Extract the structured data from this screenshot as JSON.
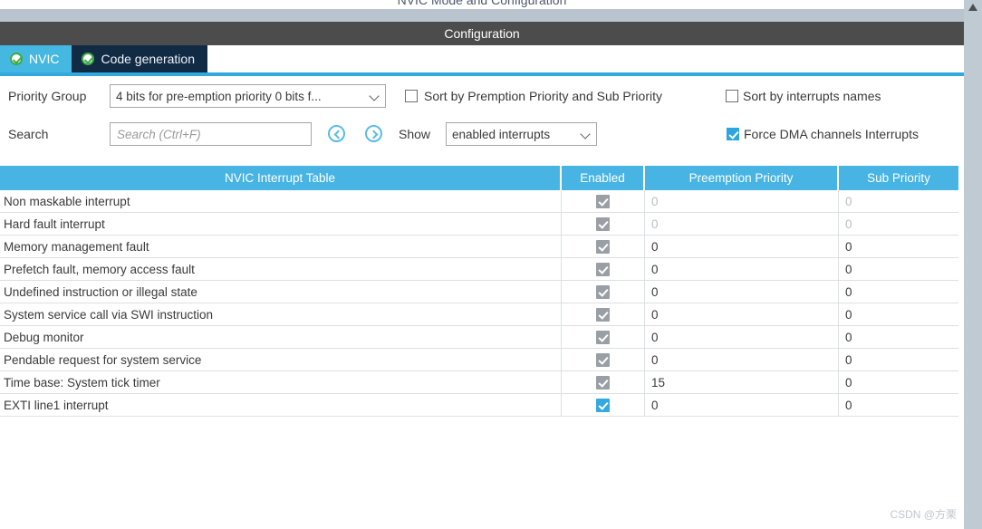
{
  "window": {
    "clipped_title": "NVIC Mode and Configuration",
    "config_bar_title": "Configuration"
  },
  "tabs": [
    {
      "label": "NVIC",
      "icon": "green-check-icon",
      "active": true
    },
    {
      "label": "Code generation",
      "icon": "green-check-icon",
      "active": false
    }
  ],
  "form": {
    "priority_group_label": "Priority Group",
    "priority_group_value": "4 bits for pre-emption priority 0 bits f...",
    "sort_by_premption_label": "Sort by Premption Priority and Sub Priority",
    "sort_by_premption_checked": false,
    "sort_by_names_label": "Sort by interrupts names",
    "sort_by_names_checked": false,
    "search_label": "Search",
    "search_value": "",
    "search_placeholder": "Search (Ctrl+F)",
    "prev_icon": "circle-left-arrow-icon",
    "next_icon": "circle-right-arrow-icon",
    "show_label": "Show",
    "show_value": "enabled interrupts",
    "force_dma_label": "Force DMA channels Interrupts",
    "force_dma_checked": true
  },
  "table": {
    "headers": {
      "name": "NVIC Interrupt Table",
      "enabled": "Enabled",
      "preemption": "Preemption Priority",
      "sub": "Sub Priority"
    },
    "rows": [
      {
        "name": "Non maskable interrupt",
        "enabled": true,
        "enabled_style": "disabled",
        "preemption": "0",
        "sub": "0",
        "value_style": "dim"
      },
      {
        "name": "Hard fault interrupt",
        "enabled": true,
        "enabled_style": "disabled",
        "preemption": "0",
        "sub": "0",
        "value_style": "dim"
      },
      {
        "name": "Memory management fault",
        "enabled": true,
        "enabled_style": "disabled",
        "preemption": "0",
        "sub": "0",
        "value_style": "normal"
      },
      {
        "name": "Prefetch fault, memory access fault",
        "enabled": true,
        "enabled_style": "disabled",
        "preemption": "0",
        "sub": "0",
        "value_style": "normal"
      },
      {
        "name": "Undefined instruction or illegal state",
        "enabled": true,
        "enabled_style": "disabled",
        "preemption": "0",
        "sub": "0",
        "value_style": "normal"
      },
      {
        "name": "System service call via SWI instruction",
        "enabled": true,
        "enabled_style": "disabled",
        "preemption": "0",
        "sub": "0",
        "value_style": "normal"
      },
      {
        "name": "Debug monitor",
        "enabled": true,
        "enabled_style": "disabled",
        "preemption": "0",
        "sub": "0",
        "value_style": "normal"
      },
      {
        "name": "Pendable request for system service",
        "enabled": true,
        "enabled_style": "disabled",
        "preemption": "0",
        "sub": "0",
        "value_style": "normal"
      },
      {
        "name": "Time base: System tick timer",
        "enabled": true,
        "enabled_style": "disabled",
        "preemption": "15",
        "sub": "0",
        "value_style": "normal"
      },
      {
        "name": "EXTI line1 interrupt",
        "enabled": true,
        "enabled_style": "active",
        "preemption": "0",
        "sub": "0",
        "value_style": "normal"
      }
    ]
  },
  "watermark": "CSDN @方栗",
  "colors": {
    "accent_blue": "#47b4e3",
    "tab_active": "#45b8e2",
    "tab_inactive": "#122b45",
    "config_bar": "#4c4c4c",
    "scrollbar": "#c0cad3",
    "check_green": "#3faa47"
  }
}
